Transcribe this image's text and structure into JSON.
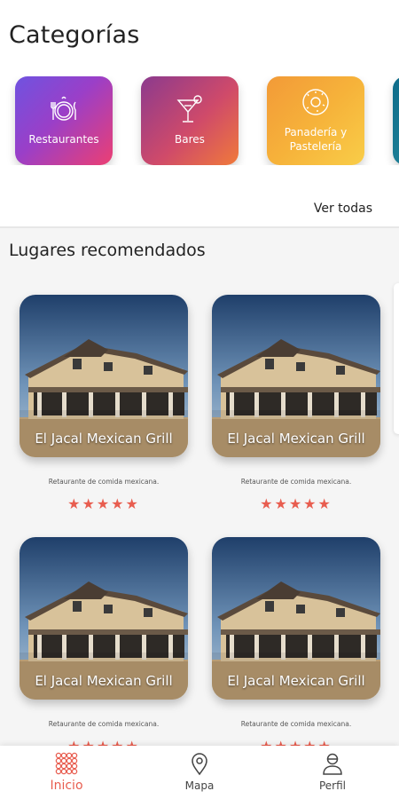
{
  "header": {
    "title": "Categorías"
  },
  "categories": [
    {
      "label": "Restaurantes",
      "icon": "plate-cutlery-icon"
    },
    {
      "label": "Bares",
      "icon": "cocktail-icon"
    },
    {
      "label": "Panadería y Pastelería",
      "icon": "donut-icon"
    },
    {
      "label": "",
      "icon": ""
    }
  ],
  "see_all": "Ver todas",
  "recommended": {
    "title": "Lugares recomendados",
    "places": [
      {
        "name": "El Jacal Mexican Grill",
        "description": "Retaurante de comida mexicana.",
        "rating": 5
      },
      {
        "name": "El Jacal Mexican Grill",
        "description": "Retaurante de comida mexicana.",
        "rating": 5
      },
      {
        "name": "El Jacal Mexican Grill",
        "description": "Retaurante de comida mexicana.",
        "rating": 5
      },
      {
        "name": "El Jacal Mexican Grill",
        "description": "Retaurante de comida mexicana.",
        "rating": 5
      }
    ]
  },
  "bottom_nav": [
    {
      "label": "Inicio",
      "icon": "grid-dots-icon",
      "active": true
    },
    {
      "label": "Mapa",
      "icon": "map-pin-icon",
      "active": false
    },
    {
      "label": "Perfil",
      "icon": "user-icon",
      "active": false
    }
  ],
  "colors": {
    "accent": "#e85d4f"
  }
}
